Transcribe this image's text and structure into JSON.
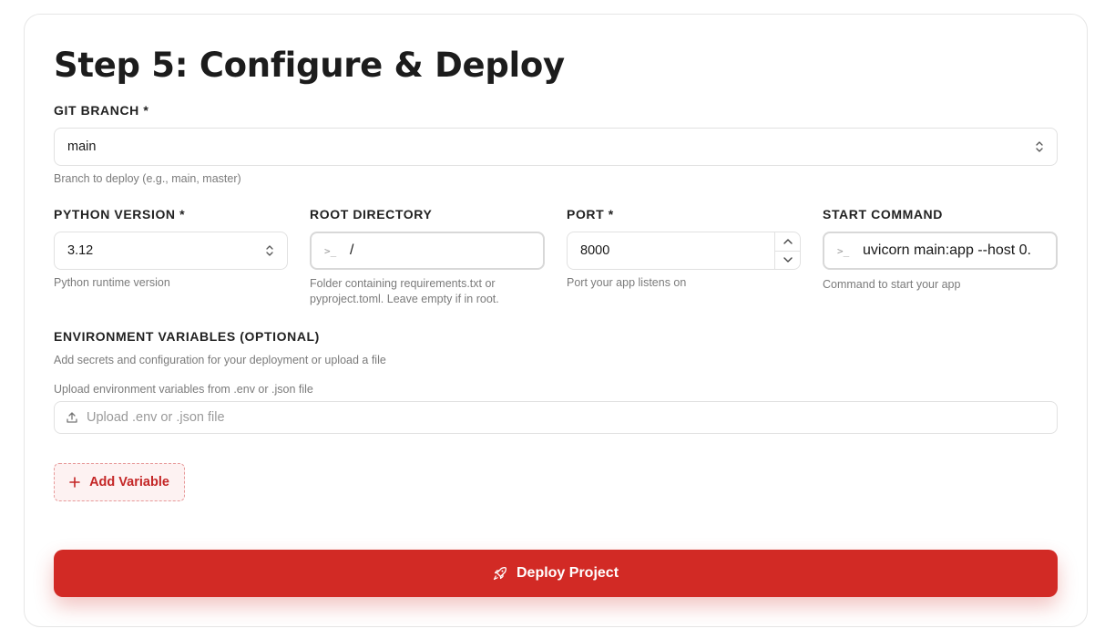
{
  "title": "Step 5: Configure & Deploy",
  "git_branch": {
    "label": "GIT BRANCH *",
    "value": "main",
    "help": "Branch to deploy (e.g., main, master)"
  },
  "python_version": {
    "label": "PYTHON VERSION *",
    "value": "3.12",
    "help": "Python runtime version"
  },
  "root_directory": {
    "label": "ROOT DIRECTORY",
    "value": "/",
    "help_line1": "Folder containing requirements.txt or",
    "help_line2": "pyproject.toml. Leave empty if in root."
  },
  "port": {
    "label": "PORT *",
    "value": "8000",
    "help": "Port your app listens on"
  },
  "start_command": {
    "label": "START COMMAND",
    "value": "uvicorn main:app --host 0.",
    "help": "Command to start your app"
  },
  "env": {
    "label": "ENVIRONMENT VARIABLES (OPTIONAL)",
    "help": "Add secrets and configuration for your deployment or upload a file",
    "upload_help": "Upload environment variables from .env or .json file",
    "upload_placeholder": "Upload .env or .json file",
    "add_button": "Add Variable"
  },
  "deploy_button": "Deploy Project",
  "colors": {
    "accent": "#d22a25",
    "accent_text": "#c42626",
    "add_bg": "#fdf2f2"
  },
  "icons": {
    "select": "chevron-up-down-icon",
    "prompt": "terminal-prompt-icon",
    "upload": "upload-icon",
    "add": "plus-icon",
    "deploy": "rocket-icon"
  }
}
